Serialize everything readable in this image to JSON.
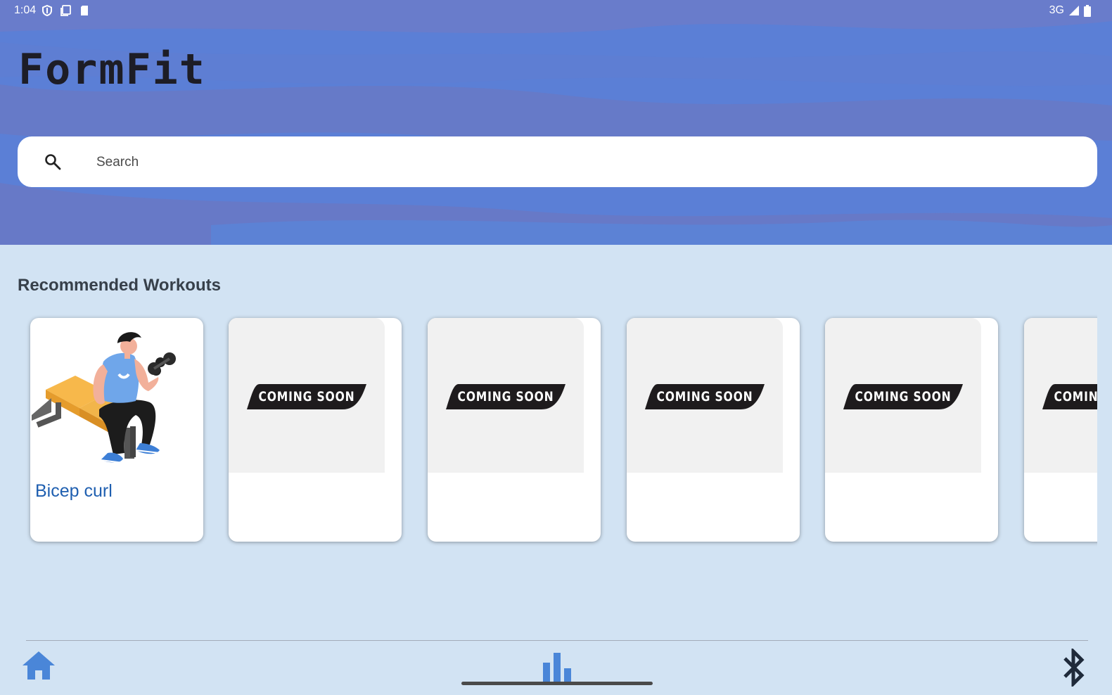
{
  "status_bar": {
    "time": "1:04",
    "left_icons": [
      "shield-icon",
      "screenshot-icon",
      "sd-card-icon"
    ],
    "network": "3G",
    "right_icons": [
      "signal-icon",
      "battery-icon"
    ]
  },
  "app": {
    "title": "FormFit"
  },
  "search": {
    "placeholder": "Search",
    "value": ""
  },
  "recommended": {
    "title": "Recommended Workouts",
    "cards": [
      {
        "name": "Bicep curl",
        "image": "bicep-curl-illustration"
      },
      {
        "badge": "COMING SOON"
      },
      {
        "badge": "COMING SOON"
      },
      {
        "badge": "COMING SOON"
      },
      {
        "badge": "COMING SOON"
      },
      {
        "badge": "COMING SOON"
      }
    ]
  },
  "bottom_nav": {
    "items": [
      "home-icon",
      "bar-chart-icon",
      "bluetooth-icon"
    ]
  },
  "colors": {
    "header_bg": "#5b7fd6",
    "page_bg": "#d2e3f3",
    "accent": "#1f5fb0",
    "nav_icon": "#4a86d8",
    "badge_bg": "#1e1b1d"
  }
}
